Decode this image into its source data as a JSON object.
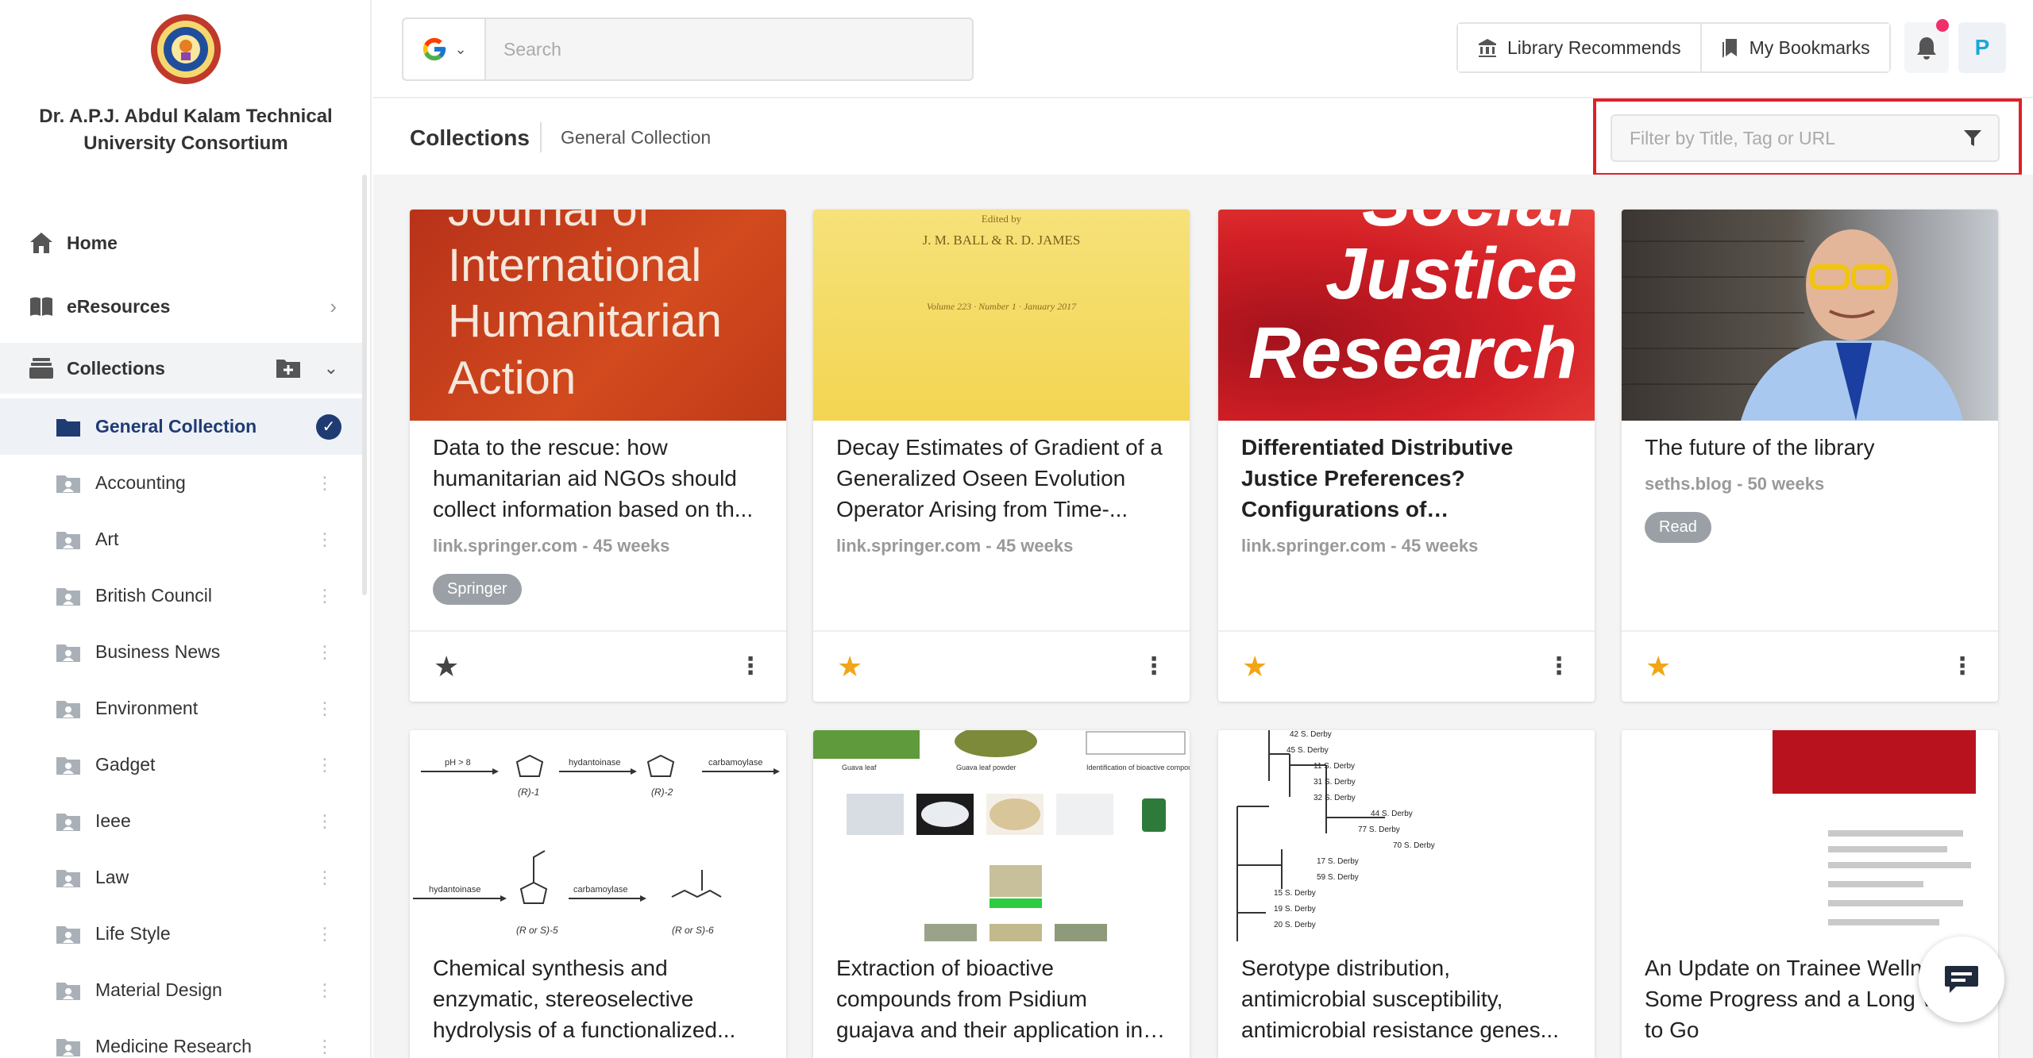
{
  "org": {
    "name": "Dr. A.P.J. Abdul Kalam Technical University Consortium"
  },
  "nav": {
    "home": "Home",
    "eresources": "eResources",
    "collections": "Collections"
  },
  "collections_list": [
    {
      "label": "General Collection"
    },
    {
      "label": "Accounting"
    },
    {
      "label": "Art"
    },
    {
      "label": "British Council"
    },
    {
      "label": "Business News"
    },
    {
      "label": "Environment"
    },
    {
      "label": "Gadget"
    },
    {
      "label": "Ieee"
    },
    {
      "label": "Law"
    },
    {
      "label": "Life Style"
    },
    {
      "label": "Material Design"
    },
    {
      "label": "Medicine Research"
    }
  ],
  "search": {
    "placeholder": "Search"
  },
  "topbar": {
    "library_recommends": "Library Recommends",
    "my_bookmarks": "My Bookmarks",
    "avatar_initial": "P"
  },
  "header": {
    "title": "Collections",
    "subtitle": "General Collection",
    "filter_placeholder": "Filter by Title, Tag or URL"
  },
  "cards": [
    {
      "thumb_text": "Journal of International Humanitarian Action",
      "title": "Data to the rescue: how humanitarian aid NGOs should collect information based on th...",
      "meta": "link.springer.com - 45 weeks",
      "tag": "Springer",
      "starred": false
    },
    {
      "thumb_text": "J. M. BALL & R. D. JAMES",
      "thumb_line1": "Edited by",
      "thumb_line3": "Volume 223 · Number 1 · January 2017",
      "title": "Decay Estimates of Gradient of a Generalized Oseen Evolution Operator Arising from Time-...",
      "meta": "link.springer.com - 45 weeks",
      "starred": true
    },
    {
      "thumb_text": "Social Justice Research",
      "title": "Differentiated Distributive Justice Preferences? Configurations of Preferences...",
      "meta": "link.springer.com - 45 weeks",
      "starred": true
    },
    {
      "title": "The future of the library",
      "meta": "seths.blog - 50 weeks",
      "tag": "Read",
      "starred": true
    },
    {
      "title": "Chemical synthesis and enzymatic, stereoselective hydrolysis of a functionalized...",
      "thumb_labels": [
        "pH > 8",
        "hydantoinase",
        "carbamoylase",
        "(R)-1",
        "(R)-2",
        "hydantoinase",
        "carbamoylase",
        "(R or S)-5",
        "(R or S)-6"
      ]
    },
    {
      "title": "Extraction of bioactive compounds from Psidium guajava and their application in dentistry",
      "thumb_labels": [
        "Guava leaf",
        "Guava leaf powder",
        "Identification of bioactive compounds by GC-MS analysis"
      ]
    },
    {
      "title": "Serotype distribution, antimicrobial susceptibility, antimicrobial resistance genes...",
      "thumb_labels": [
        "42 S. Derby",
        "45 S. Derby",
        "11 S. Derby",
        "31 S. Derby",
        "32 S. Derby",
        "44 S. Derby",
        "77 S. Derby",
        "70 S. Derby",
        "17 S. Derby",
        "59 S. Derby",
        "15 S. Derby",
        "19 S. Derby",
        "20 S. Derby"
      ]
    },
    {
      "title": "An Update on Trainee Wellness: Some Progress and a Long Way to Go"
    }
  ],
  "colors": {
    "accent": "#1f3b73",
    "highlight": "#e0202a",
    "star": "#f2a516",
    "notification": "#f0306b"
  }
}
